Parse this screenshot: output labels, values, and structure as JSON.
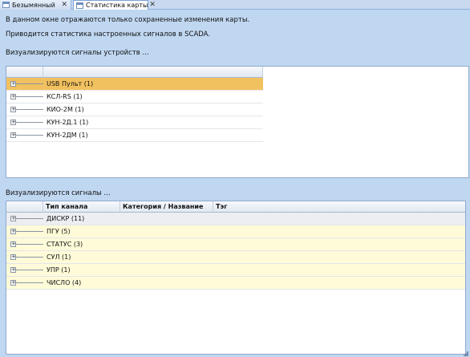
{
  "tabs": [
    {
      "label": "Безымянный",
      "close": "✕"
    },
    {
      "label": "Статистика карты",
      "close": "✕"
    }
  ],
  "info": {
    "line1": "В данном окне отражаются только сохраненные изменения карты.",
    "line2": "Приводится статистика настроенных сигналов в SCADA.",
    "devices_caption": "Визуализируются сигналы устройств ...",
    "signals_caption": "Визуализируются сигналы ..."
  },
  "devices_grid": {
    "rows": [
      {
        "label": "USB Пульт (1)",
        "selected": true
      },
      {
        "label": "КСЛ-RS (1)"
      },
      {
        "label": "КИО-2М (1)"
      },
      {
        "label": "КУН-2Д.1 (1)"
      },
      {
        "label": "КУН-2ДМ (1)"
      }
    ]
  },
  "signals_grid": {
    "columns": [
      "Тип канала",
      "Категория / Название",
      "Тэг"
    ],
    "rows": [
      {
        "label": "ДИСКР (11)"
      },
      {
        "label": "ПГУ (5)"
      },
      {
        "label": "СТАТУС (3)"
      },
      {
        "label": "СУЛ (1)"
      },
      {
        "label": "УПР (1)"
      },
      {
        "label": "ЧИСЛО (4)"
      }
    ]
  },
  "expander_glyph": "+"
}
